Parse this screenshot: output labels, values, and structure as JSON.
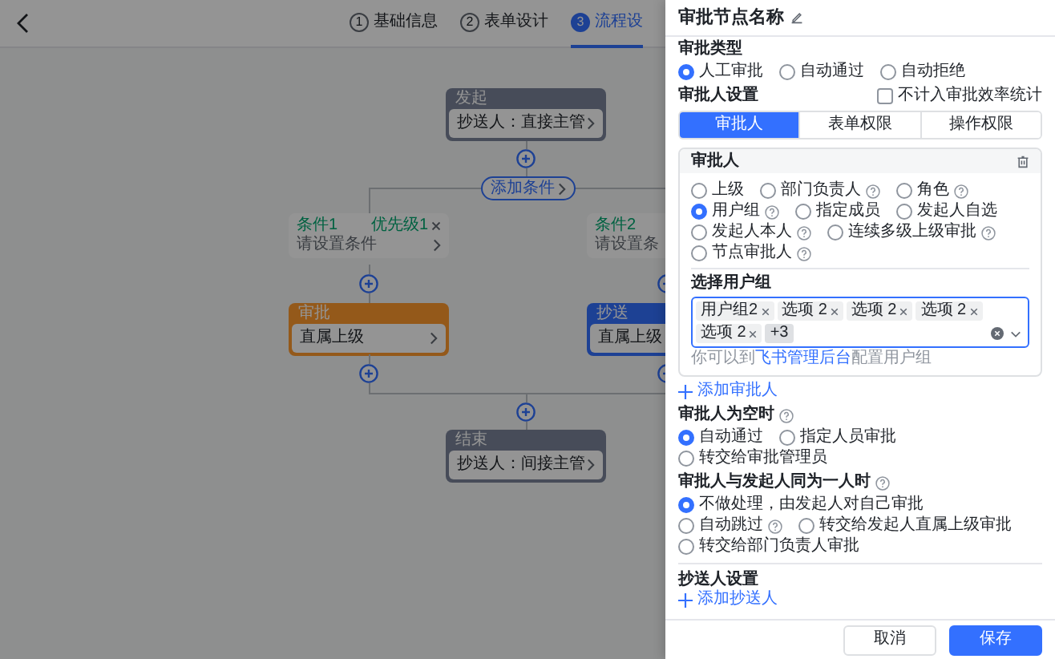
{
  "header": {
    "steps": [
      {
        "number": "1",
        "label": "基础信息",
        "selected": false
      },
      {
        "number": "2",
        "label": "表单设计",
        "selected": false
      },
      {
        "number": "3",
        "label": "流程设",
        "selected": true
      }
    ]
  },
  "flow": {
    "start": {
      "kind": "start",
      "title": "发起",
      "text": "抄送人：直接主管"
    },
    "add_condition": "添加条件",
    "branches": [
      {
        "condition": {
          "title": "条件1",
          "priority": "优先级1",
          "text": "请设置条件"
        },
        "node": {
          "kind": "approver",
          "title": "审批",
          "text": "直属上级"
        }
      },
      {
        "condition": {
          "title": "条件2",
          "text": "请设置条"
        },
        "node": {
          "kind": "cc",
          "title": "抄送",
          "text": "直属上级"
        }
      }
    ],
    "end": {
      "kind": "end",
      "title": "结束",
      "text": "抄送人：间接主管"
    }
  },
  "drawer": {
    "title": "审批节点名称",
    "approval_type": {
      "label": "审批类型",
      "options": [
        {
          "label": "人工审批",
          "selected": true,
          "help": false
        },
        {
          "label": "自动通过",
          "selected": false,
          "help": false
        },
        {
          "label": "自动拒绝",
          "selected": false,
          "help": false
        }
      ]
    },
    "approver_settings": {
      "label": "审批人设置",
      "exclude_stats": {
        "label": "不计入审批效率统计",
        "checked": false
      },
      "tabs": [
        {
          "label": "审批人",
          "selected": true
        },
        {
          "label": "表单权限",
          "selected": false
        },
        {
          "label": "操作权限",
          "selected": false
        }
      ]
    },
    "approver_card": {
      "title": "审批人",
      "options": [
        {
          "label": "上级",
          "selected": false,
          "help": false
        },
        {
          "label": "部门负责人",
          "selected": false,
          "help": true
        },
        {
          "label": "角色",
          "selected": false,
          "help": true
        },
        {
          "label": "用户组",
          "selected": true,
          "help": true
        },
        {
          "label": "指定成员",
          "selected": false,
          "help": false
        },
        {
          "label": "发起人自选",
          "selected": false,
          "help": false
        },
        {
          "label": "发起人本人",
          "selected": false,
          "help": true
        },
        {
          "label": "连续多级上级审批",
          "selected": false,
          "help": true
        },
        {
          "label": "节点审批人",
          "selected": false,
          "help": true
        }
      ],
      "group_label": "选择用户组",
      "tags": [
        "用户组2",
        "选项 2",
        "选项 2",
        "选项 2",
        "选项 2"
      ],
      "more": "+3",
      "hint": {
        "before": "你可以到",
        "link": "飞书管理后台",
        "after": "配置用户组"
      }
    },
    "add_approver": "添加审批人",
    "empty_approver": {
      "label": "审批人为空时",
      "help": true,
      "options": [
        {
          "label": "自动通过",
          "selected": true,
          "help": false
        },
        {
          "label": "指定人员审批",
          "selected": false,
          "help": false
        },
        {
          "label": "转交给审批管理员",
          "selected": false,
          "help": false
        }
      ]
    },
    "same_person": {
      "label": "审批人与发起人同为一人时",
      "help": true,
      "options": [
        {
          "label": "不做处理，由发起人对自己审批",
          "selected": true,
          "help": false
        },
        {
          "label": "自动跳过",
          "selected": false,
          "help": true
        },
        {
          "label": "转交给发起人直属上级审批",
          "selected": false,
          "help": false
        },
        {
          "label": "转交给部门负责人审批",
          "selected": false,
          "help": false
        }
      ]
    },
    "cc": {
      "label": "抄送人设置",
      "add": "添加抄送人"
    },
    "footer": {
      "buttons": [
        {
          "label": "取消",
          "kind": "secondary"
        },
        {
          "label": "保存",
          "kind": "primary"
        }
      ]
    }
  }
}
